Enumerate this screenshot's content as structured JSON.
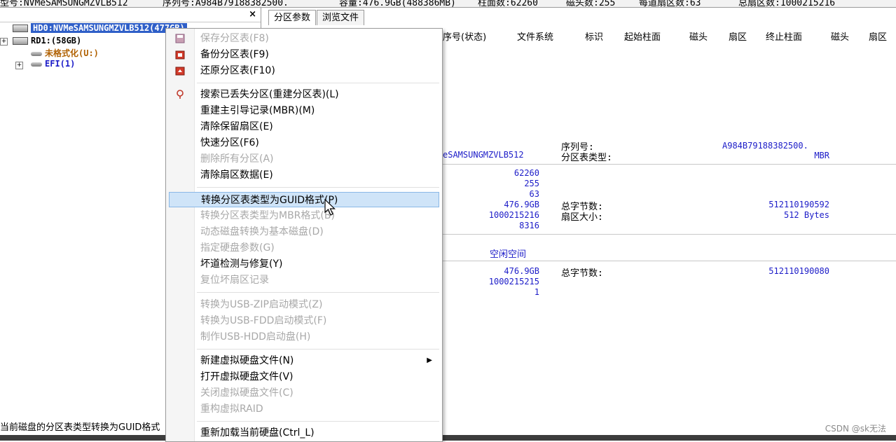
{
  "topbar": {
    "model": "型号:NVMeSAMSUNGMZVLB512",
    "serial": "序列号:A984B79188382500.",
    "capacity": "容量:476.9GB(488386MB)",
    "cylinders": "柱面数:62260",
    "heads": "磁头数:255",
    "sectors_per_track": "每道扇区数:63",
    "total_sectors": "总扇区数:1000215216"
  },
  "tree": {
    "close": "×",
    "hd0": "HD0:NVMeSAMSUNGMZVLB512(477GB)",
    "rd1": "RD1:(58GB)",
    "unformatted": "未格式化(U:)",
    "efi": "EFI(1)"
  },
  "tabs": [
    "分区参数",
    "浏览文件"
  ],
  "columns": [
    "序号(状态)",
    "文件系统",
    "标识",
    "起始柱面",
    "磁头",
    "扇区",
    "终止柱面",
    "磁头",
    "扇区"
  ],
  "disk_info": {
    "model_tail": "eSAMSUNGMZVLB512",
    "serial_label": "序列号:",
    "serial_value": "A984B79188382500.",
    "ptype_label": "分区表类型:",
    "ptype_value": "MBR",
    "cylinders": "62260",
    "heads": "255",
    "sectors": "63",
    "capacity": "476.9GB",
    "total_sectors": "1000215216",
    "extra": "8316",
    "total_bytes_label": "总字节数:",
    "total_bytes_value": "512110190592",
    "sector_size_label": "扇区大小:",
    "sector_size_value": "512 Bytes"
  },
  "free_space": {
    "title": "空闲空间",
    "capacity": "476.9GB",
    "sectors": "1000215215",
    "start": "1",
    "total_bytes_label": "总字节数:",
    "total_bytes_value": "512110190080"
  },
  "context_menu": {
    "items": [
      {
        "label": "保存分区表(F8)",
        "disabled": true,
        "icon": "save-icon"
      },
      {
        "label": "备份分区表(F9)",
        "disabled": false,
        "icon": "backup-icon"
      },
      {
        "label": "还原分区表(F10)",
        "disabled": false,
        "icon": "restore-icon"
      },
      {
        "label": "搜索已丢失分区(重建分区表)(L)",
        "disabled": false,
        "icon": "search-icon"
      },
      {
        "label": "重建主引导记录(MBR)(M)",
        "disabled": false
      },
      {
        "label": "清除保留扇区(E)",
        "disabled": false
      },
      {
        "label": "快速分区(F6)",
        "disabled": false
      },
      {
        "label": "删除所有分区(A)",
        "disabled": true
      },
      {
        "label": "清除扇区数据(E)",
        "disabled": false
      },
      {
        "label": "转换分区表类型为GUID格式(P)",
        "disabled": false,
        "highlighted": true
      },
      {
        "label": "转换分区表类型为MBR格式(B)",
        "disabled": true
      },
      {
        "label": "动态磁盘转换为基本磁盘(D)",
        "disabled": true
      },
      {
        "label": "指定硬盘参数(G)",
        "disabled": true
      },
      {
        "label": "坏道检测与修复(Y)",
        "disabled": false
      },
      {
        "label": "复位坏扇区记录",
        "disabled": true
      },
      {
        "label": "转换为USB-ZIP启动模式(Z)",
        "disabled": true
      },
      {
        "label": "转换为USB-FDD启动模式(F)",
        "disabled": true
      },
      {
        "label": "制作USB-HDD启动盘(H)",
        "disabled": true
      },
      {
        "label": "新建虚拟硬盘文件(N)",
        "disabled": false,
        "submenu": true
      },
      {
        "label": "打开虚拟硬盘文件(V)",
        "disabled": false
      },
      {
        "label": "关闭虚拟硬盘文件(C)",
        "disabled": true
      },
      {
        "label": "重构虚拟RAID",
        "disabled": true
      },
      {
        "label": "重新加载当前硬盘(Ctrl_L)",
        "disabled": false
      }
    ]
  },
  "status": "当前磁盘的分区表类型转换为GUID格式",
  "watermark": "CSDN @sk无法",
  "colors": {
    "selection": "#2f5fc8",
    "value_blue": "#1c1cc8",
    "menu_highlight": "#cfe4f8",
    "unformatted_text": "#b06000"
  }
}
